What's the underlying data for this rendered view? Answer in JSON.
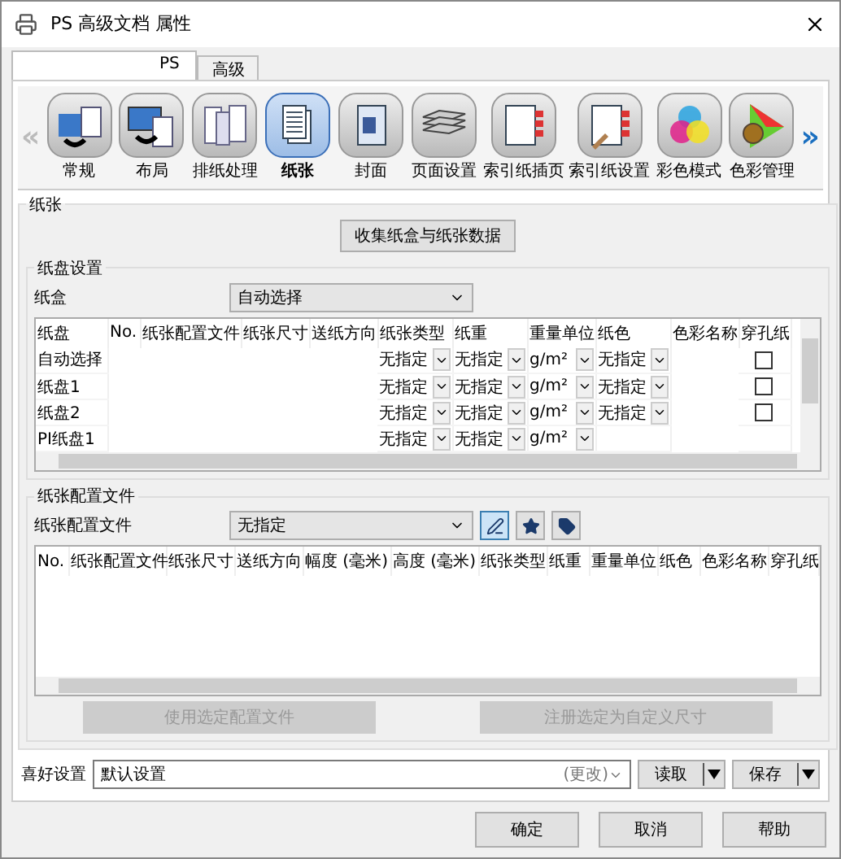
{
  "window": {
    "title": "PS 高级文档 属性"
  },
  "tabs": [
    {
      "label": "PS",
      "selected": true
    },
    {
      "label": "高级",
      "selected": false
    }
  ],
  "toolbar": {
    "prev": "«",
    "next": "»",
    "items": [
      {
        "label": "常规",
        "kind": "general",
        "selected": false
      },
      {
        "label": "布局",
        "kind": "layout",
        "selected": false
      },
      {
        "label": "排纸处理",
        "kind": "finishing",
        "selected": false
      },
      {
        "label": "纸张",
        "kind": "paper",
        "selected": true
      },
      {
        "label": "封面",
        "kind": "cover",
        "selected": false
      },
      {
        "label": "页面设置",
        "kind": "stack",
        "selected": false
      },
      {
        "label": "索引纸插页",
        "kind": "tabs",
        "selected": false
      },
      {
        "label": "索引纸设置",
        "kind": "tabset",
        "selected": false
      },
      {
        "label": "彩色模式",
        "kind": "colormode",
        "selected": false
      },
      {
        "label": "色彩管理",
        "kind": "colormgmt",
        "selected": false
      }
    ]
  },
  "paper": {
    "title": "纸张",
    "collect_button": "收集纸盒与纸张数据",
    "tray_settings": {
      "title": "纸盘设置",
      "tray_label": "纸盒",
      "tray_value": "自动选择",
      "columns": [
        "纸盘",
        "No.",
        "纸张配置文件",
        "纸张尺寸",
        "送纸方向",
        "纸张类型",
        "纸重",
        "重量单位",
        "纸色",
        "色彩名称",
        "穿孔纸"
      ],
      "rows": [
        {
          "tray": "自动选择",
          "type": "无指定",
          "weight": "无指定",
          "unit": "g/m²",
          "paper_color": "无指定",
          "punched": false
        },
        {
          "tray": "纸盘1",
          "type": "无指定",
          "weight": "无指定",
          "unit": "g/m²",
          "paper_color": "无指定",
          "punched": false
        },
        {
          "tray": "纸盘2",
          "type": "无指定",
          "weight": "无指定",
          "unit": "g/m²",
          "paper_color": "无指定",
          "punched": false
        },
        {
          "tray": "PI纸盘1",
          "type": "无指定",
          "weight": "无指定",
          "unit": "g/m²"
        }
      ]
    },
    "profiles": {
      "title": "纸张配置文件",
      "label": "纸张配置文件",
      "value": "无指定",
      "tools": [
        {
          "kind": "edit",
          "selected": true
        },
        {
          "kind": "star",
          "selected": false
        },
        {
          "kind": "tag",
          "selected": false
        }
      ],
      "columns": [
        "No.",
        "纸张配置文件",
        "纸张尺寸",
        "送纸方向",
        "幅度 (毫米)",
        "高度 (毫米)",
        "纸张类型",
        "纸重",
        "重量单位",
        "纸色",
        "色彩名称",
        "穿孔纸"
      ],
      "use_button": {
        "label": "使用选定配置文件",
        "disabled": true
      },
      "register_button": {
        "label": "注册选定为自定义尺寸",
        "disabled": true
      }
    }
  },
  "favorites": {
    "label": "喜好设置",
    "value": "默认设置",
    "hint": "(更改)",
    "load": "读取",
    "save": "保存"
  },
  "buttons": [
    "确定",
    "取消",
    "帮助"
  ]
}
